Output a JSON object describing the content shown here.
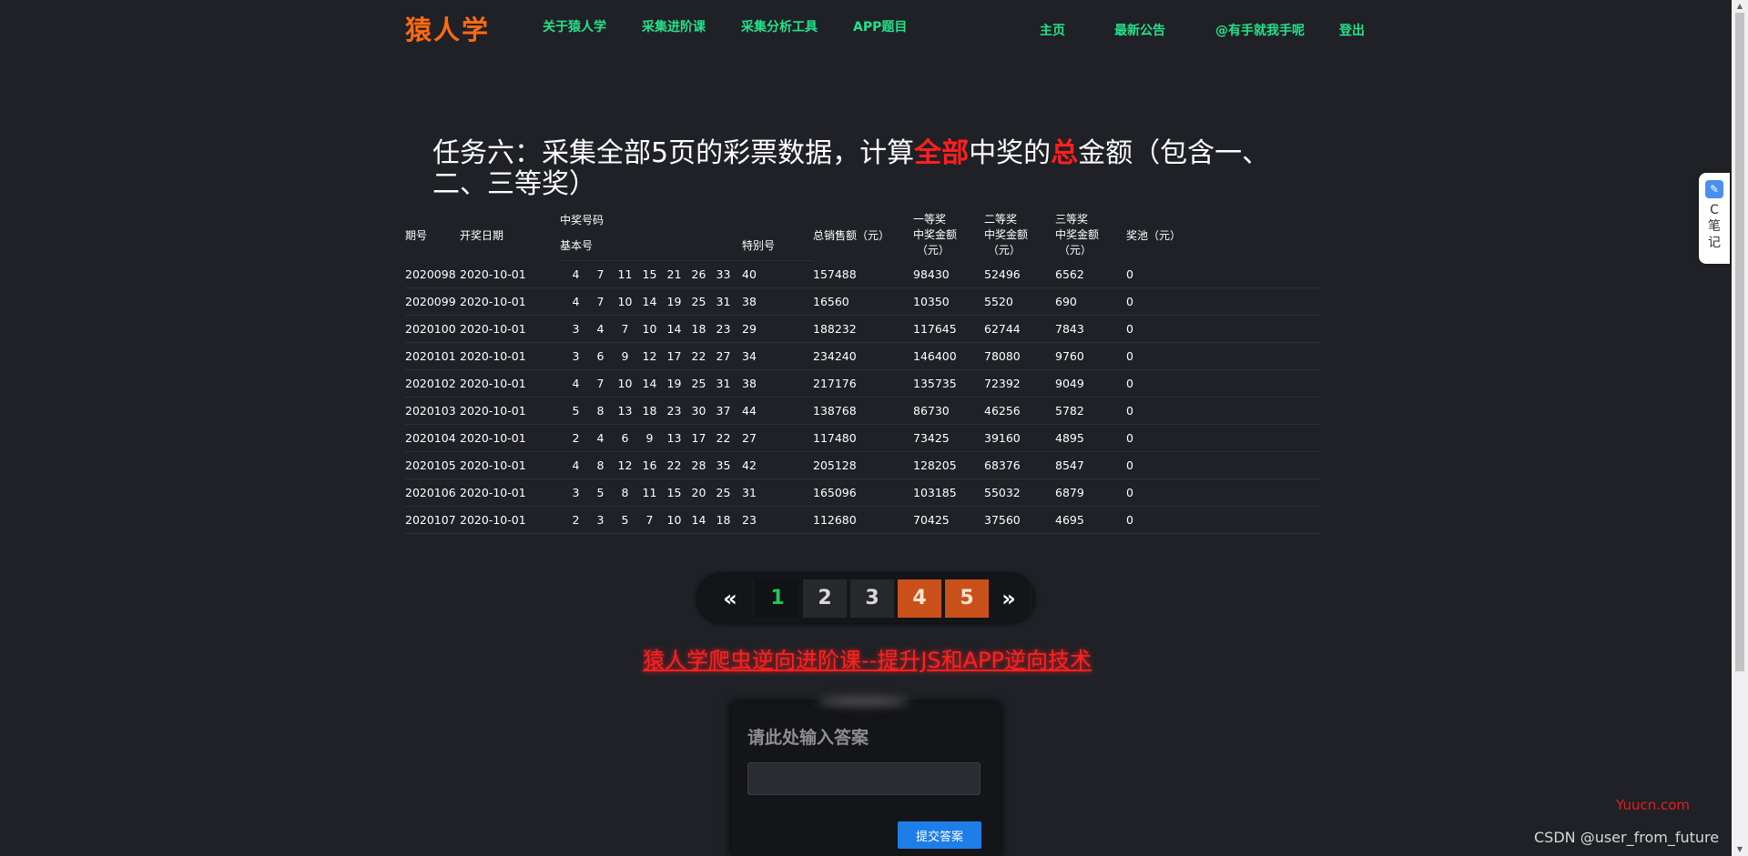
{
  "header": {
    "logo": "猿人学",
    "nav_left": [
      "关于猿人学",
      "采集进阶课",
      "采集分析工具",
      "APP题目"
    ],
    "nav_right": [
      "主页",
      "最新公告",
      "@有手就我手呢",
      "登出"
    ]
  },
  "title": {
    "part1": "任务六：采集全部5页的彩票数据，计算",
    "hl1": "全部",
    "part2": "中奖的",
    "hl2": "总",
    "part3": "金额（包含一、二、三等奖）"
  },
  "table": {
    "headers": {
      "issue": "期号",
      "date": "开奖日期",
      "winning_numbers": "中奖号码",
      "basic": "基本号",
      "special": "特别号",
      "sales": "总销售额（元）",
      "first_a": "一等奖",
      "first_b": "中奖金额",
      "first_c": "（元）",
      "second_a": "二等奖",
      "second_b": "中奖金额",
      "second_c": "（元）",
      "third_a": "三等奖",
      "third_b": "中奖金额",
      "third_c": "（元）",
      "pool": "奖池（元）"
    },
    "rows": [
      {
        "issue": "2020098",
        "date": "2020-10-01",
        "basic": [
          "4",
          "7",
          "11",
          "15",
          "21",
          "26",
          "33"
        ],
        "special": "40",
        "sales": "157488",
        "first": "98430",
        "second": "52496",
        "third": "6562",
        "pool": "0"
      },
      {
        "issue": "2020099",
        "date": "2020-10-01",
        "basic": [
          "4",
          "7",
          "10",
          "14",
          "19",
          "25",
          "31"
        ],
        "special": "38",
        "sales": "16560",
        "first": "10350",
        "second": "5520",
        "third": "690",
        "pool": "0"
      },
      {
        "issue": "2020100",
        "date": "2020-10-01",
        "basic": [
          "3",
          "4",
          "7",
          "10",
          "14",
          "18",
          "23"
        ],
        "special": "29",
        "sales": "188232",
        "first": "117645",
        "second": "62744",
        "third": "7843",
        "pool": "0"
      },
      {
        "issue": "2020101",
        "date": "2020-10-01",
        "basic": [
          "3",
          "6",
          "9",
          "12",
          "17",
          "22",
          "27"
        ],
        "special": "34",
        "sales": "234240",
        "first": "146400",
        "second": "78080",
        "third": "9760",
        "pool": "0"
      },
      {
        "issue": "2020102",
        "date": "2020-10-01",
        "basic": [
          "4",
          "7",
          "10",
          "14",
          "19",
          "25",
          "31"
        ],
        "special": "38",
        "sales": "217176",
        "first": "135735",
        "second": "72392",
        "third": "9049",
        "pool": "0"
      },
      {
        "issue": "2020103",
        "date": "2020-10-01",
        "basic": [
          "5",
          "8",
          "13",
          "18",
          "23",
          "30",
          "37"
        ],
        "special": "44",
        "sales": "138768",
        "first": "86730",
        "second": "46256",
        "third": "5782",
        "pool": "0"
      },
      {
        "issue": "2020104",
        "date": "2020-10-01",
        "basic": [
          "2",
          "4",
          "6",
          "9",
          "13",
          "17",
          "22"
        ],
        "special": "27",
        "sales": "117480",
        "first": "73425",
        "second": "39160",
        "third": "4895",
        "pool": "0"
      },
      {
        "issue": "2020105",
        "date": "2020-10-01",
        "basic": [
          "4",
          "8",
          "12",
          "16",
          "22",
          "28",
          "35"
        ],
        "special": "42",
        "sales": "205128",
        "first": "128205",
        "second": "68376",
        "third": "8547",
        "pool": "0"
      },
      {
        "issue": "2020106",
        "date": "2020-10-01",
        "basic": [
          "3",
          "5",
          "8",
          "11",
          "15",
          "20",
          "25"
        ],
        "special": "31",
        "sales": "165096",
        "first": "103185",
        "second": "55032",
        "third": "6879",
        "pool": "0"
      },
      {
        "issue": "2020107",
        "date": "2020-10-01",
        "basic": [
          "2",
          "3",
          "5",
          "7",
          "10",
          "14",
          "18"
        ],
        "special": "23",
        "sales": "112680",
        "first": "70425",
        "second": "37560",
        "third": "4695",
        "pool": "0"
      }
    ]
  },
  "pagination": {
    "prev": "«",
    "pages": [
      "1",
      "2",
      "3",
      "4",
      "5"
    ],
    "next": "»",
    "active": "1"
  },
  "promo": "猿人学爬虫逆向进阶课--提升JS和APP逆向技术",
  "answer": {
    "label": "请此处输入答案",
    "input_value": "",
    "submit": "提交答案"
  },
  "side_widget": {
    "text": "C笔记"
  },
  "watermarks": {
    "site": "Yuucn.com",
    "csdn": "CSDN @user_from_future"
  },
  "colors": {
    "background": "#1f2126",
    "nav_green": "#25e08a",
    "logo_orange": "#ff6a14",
    "highlight_red": "#ff1f1f",
    "page_orange": "#c9501a",
    "active_page_green": "#22c55e",
    "button_blue": "#1e7ee8"
  }
}
